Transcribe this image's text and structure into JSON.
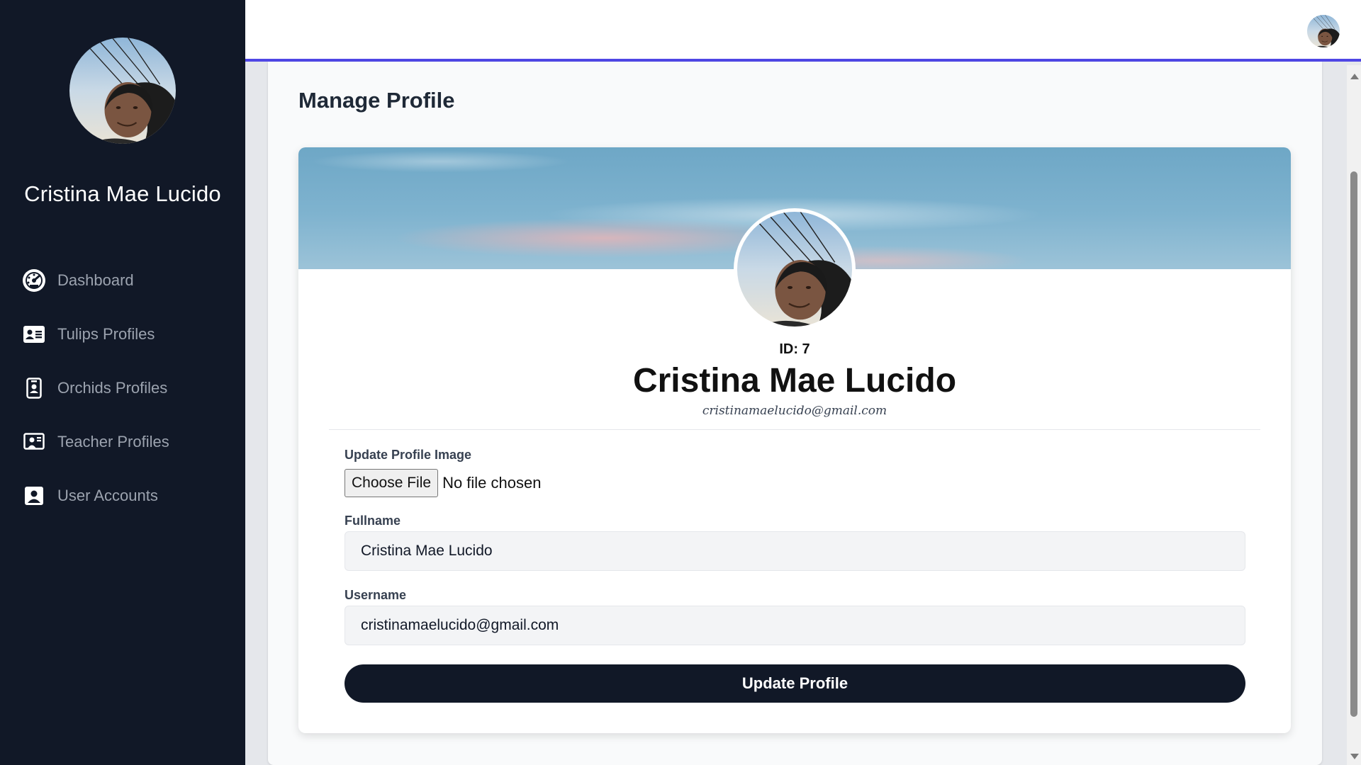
{
  "sidebar": {
    "user_name": "Cristina Mae Lucido",
    "items": [
      {
        "label": "Dashboard",
        "icon": "gauge-icon"
      },
      {
        "label": "Tulips Profiles",
        "icon": "id-card-icon"
      },
      {
        "label": "Orchids Profiles",
        "icon": "id-badge-icon"
      },
      {
        "label": "Teacher Profiles",
        "icon": "teacher-icon"
      },
      {
        "label": "User Accounts",
        "icon": "user-square-icon"
      }
    ]
  },
  "header": {
    "accent_color": "#4f46e5"
  },
  "main": {
    "page_title": "Manage Profile",
    "profile": {
      "id_text": "ID: 7",
      "full_name": "Cristina Mae Lucido",
      "email": "cristinamaelucido@gmail.com"
    },
    "form": {
      "image_label": "Update Profile Image",
      "choose_file_label": "Choose File",
      "file_status": "No file chosen",
      "fullname_label": "Fullname",
      "fullname_value": "Cristina Mae Lucido",
      "username_label": "Username",
      "username_value": "cristinamaelucido@gmail.com",
      "submit_label": "Update Profile"
    }
  },
  "colors": {
    "sidebar_bg": "#111827",
    "button_bg": "#111827",
    "nav_text": "#9ca3af"
  }
}
